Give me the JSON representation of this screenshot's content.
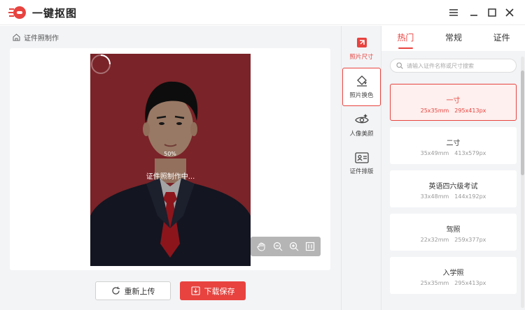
{
  "app": {
    "title": "一键抠图"
  },
  "window": {
    "icons": [
      "menu-icon",
      "minimize-icon",
      "maximize-icon",
      "close-icon"
    ]
  },
  "breadcrumb": {
    "label": "证件照制作"
  },
  "editor": {
    "progress": "50%",
    "status": "证件照制作中...",
    "tools": [
      "hand-icon",
      "zoom-out-icon",
      "zoom-in-icon",
      "fit-icon"
    ]
  },
  "actions": {
    "reupload": "重新上传",
    "save": "下载保存"
  },
  "tool_column": [
    {
      "label": "照片尺寸",
      "icon": "crop-icon"
    },
    {
      "label": "照片换色",
      "icon": "paint-bucket-icon"
    },
    {
      "label": "人像美颜",
      "icon": "eye-icon"
    },
    {
      "label": "证件排版",
      "icon": "id-card-icon"
    }
  ],
  "tabs": [
    "热门",
    "常规",
    "证件"
  ],
  "search": {
    "placeholder": "请输入证件名称或尺寸搜索"
  },
  "specs": [
    {
      "name": "一寸",
      "mm": "25x35mm",
      "px": "295x413px"
    },
    {
      "name": "二寸",
      "mm": "35x49mm",
      "px": "413x579px"
    },
    {
      "name": "英语四六级考试",
      "mm": "33x48mm",
      "px": "144x192px"
    },
    {
      "name": "驾照",
      "mm": "22x32mm",
      "px": "259x377px"
    },
    {
      "name": "入学照",
      "mm": "25x35mm",
      "px": "295x413px"
    }
  ],
  "colors": {
    "accent": "#e8433f",
    "photo_background": "#b4343b"
  }
}
